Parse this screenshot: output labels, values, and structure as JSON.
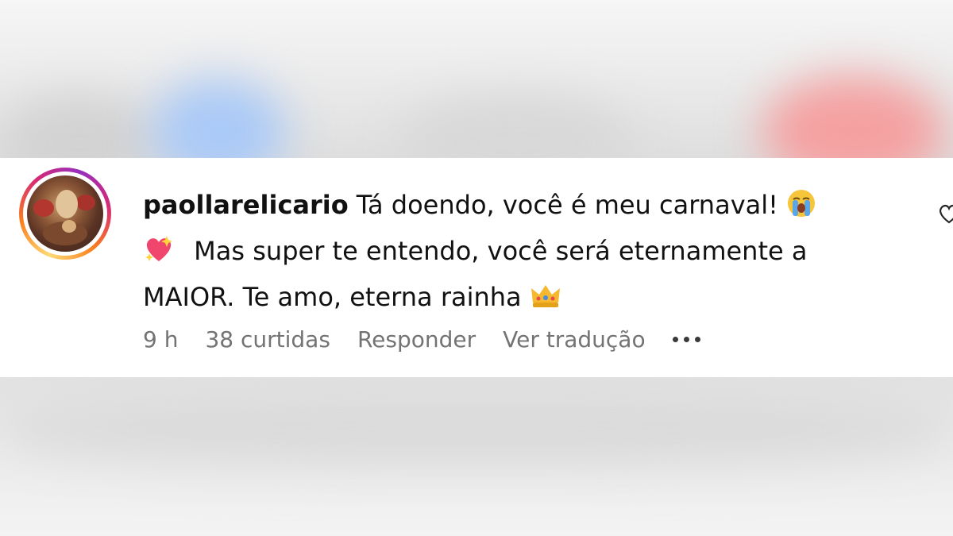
{
  "comment": {
    "username": "paollarelicario",
    "line1": "Tá doendo, você é meu carnaval!",
    "line2": "Mas super te entendo, você será eternamente a",
    "line3": "MAIOR. Te amo, eterna rainha",
    "emojis": [
      "loudly-crying-face-emoji",
      "sparkling-heart-emoji",
      "crown-emoji"
    ]
  },
  "meta": {
    "time": "9 h",
    "likes": "38 curtidas",
    "reply": "Responder",
    "translate": "Ver tradução"
  },
  "colors": {
    "meta_text": "#737373",
    "text": "#111111",
    "ring_start": "#feda75",
    "ring_end": "#962fbf"
  },
  "icons": [
    "avatar",
    "like-heart-icon",
    "more-options-icon"
  ]
}
